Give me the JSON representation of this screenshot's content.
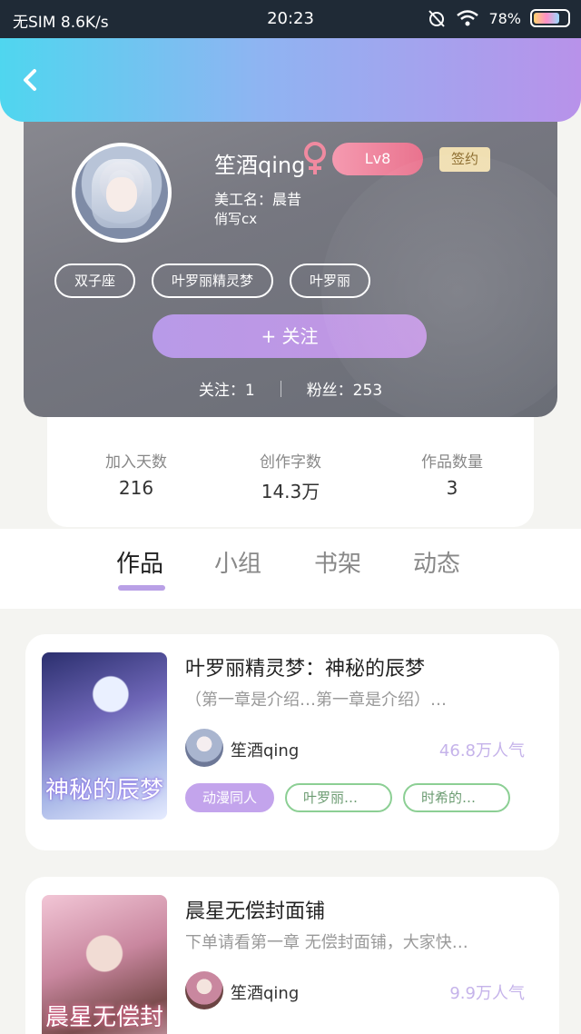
{
  "status_bar": {
    "carrier": "无SIM 8.6K/s",
    "time": "20:23",
    "battery": "78%",
    "battery_level": 0.78
  },
  "header": {
    "back_icon": "chevron-left-icon"
  },
  "profile": {
    "nickname": "笙酒qing",
    "gender_icon": "female-icon",
    "level": "Lv8",
    "sign_badge": "签约",
    "info_line1": "美工名：晨昔",
    "info_line2": "俏写cx",
    "tags": [
      "双子座",
      "叶罗丽精灵梦",
      "叶罗丽"
    ],
    "follow_button": "+ 关注",
    "following": "关注：1",
    "fans": "粉丝：253"
  },
  "data_stats": [
    {
      "label": "加入天数",
      "value": "216"
    },
    {
      "label": "创作字数",
      "value": "14.3万"
    },
    {
      "label": "作品数量",
      "value": "3"
    }
  ],
  "tabs": [
    "作品",
    "小组",
    "书架",
    "动态"
  ],
  "active_tab": "作品",
  "works": [
    {
      "title": "叶罗丽精灵梦：神秘的辰梦",
      "desc": "（第一章是介绍…第一章是介绍）…",
      "cover_text": "神秘的辰梦",
      "author": "笙酒qing",
      "popularity": "46.8万人气",
      "tags": [
        "动漫同人",
        "叶罗丽…",
        "时希的…"
      ]
    },
    {
      "title": "晨星无偿封面铺",
      "desc": "下单请看第一章 无偿封面铺，大家快…",
      "cover_text": "晨星无偿封面铺",
      "author": "笙酒qing",
      "popularity": "9.9万人气"
    }
  ],
  "colors": {
    "header_gradient_start": "#4fd6ef",
    "header_gradient_end": "#b892ea",
    "accent_purple": "#c3a4ec",
    "tag_green": "#8ccf94"
  }
}
